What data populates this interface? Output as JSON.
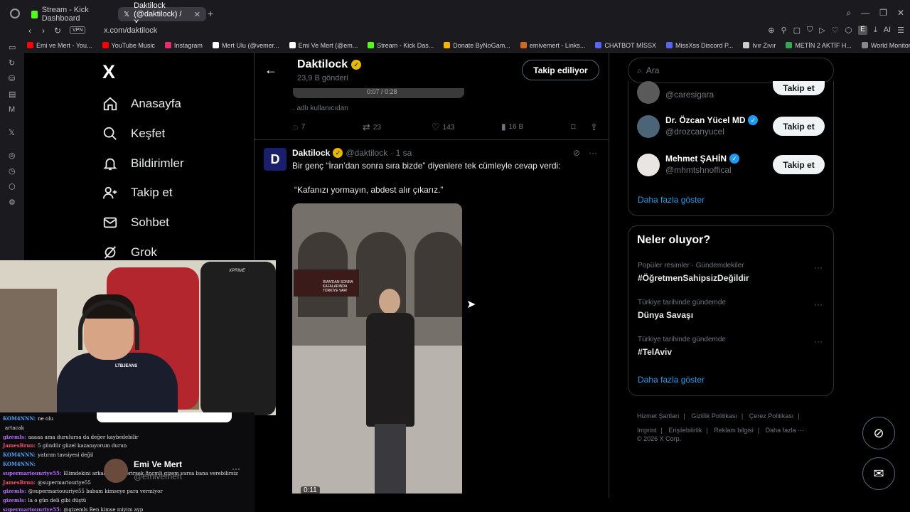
{
  "browser": {
    "tabs": [
      {
        "label": "Stream - Kick Dashboard",
        "color": "#53fc18",
        "active": false
      },
      {
        "label": "Daktilock (@daktilock) / X",
        "color": "#ffffff",
        "active": true
      }
    ],
    "url": "x.com/daktilock",
    "vpn_label": "VPN",
    "ext_label": "E",
    "ai_label": "AI",
    "bookmarks": [
      {
        "label": "Emi ve Mert - You...",
        "color": "#ff0000"
      },
      {
        "label": "YouTube Music",
        "color": "#ff0000"
      },
      {
        "label": "Instagram",
        "color": "#e1306c"
      },
      {
        "label": "Mert Ulu (@vemer...",
        "color": "#ffffff"
      },
      {
        "label": "Emi Ve Mert (@em...",
        "color": "#ffffff"
      },
      {
        "label": "Stream - Kick Das...",
        "color": "#53fc18"
      },
      {
        "label": "Donate ByNoGam...",
        "color": "#f5b400"
      },
      {
        "label": "emivemert - Links...",
        "color": "#d2691e"
      },
      {
        "label": "CHATBOT MİSSX",
        "color": "#5865f2"
      },
      {
        "label": "MissXss Discord P...",
        "color": "#5865f2"
      },
      {
        "label": "Ivır Zıvır",
        "color": "#cccccc"
      },
      {
        "label": "METİN 2 AKTİF H...",
        "color": "#34a853"
      },
      {
        "label": "World Monitor - R...",
        "color": "#888888"
      }
    ]
  },
  "nav": {
    "logo": "X",
    "items": [
      {
        "label": "Anasayfa",
        "icon": "home-icon"
      },
      {
        "label": "Keşfet",
        "icon": "search-icon"
      },
      {
        "label": "Bildirimler",
        "icon": "bell-icon"
      },
      {
        "label": "Takip et",
        "icon": "follow-icon"
      },
      {
        "label": "Sohbet",
        "icon": "mail-icon"
      },
      {
        "label": "Grok",
        "icon": "grok-icon"
      }
    ]
  },
  "profile": {
    "name": "Daktilock",
    "posts": "23,9 B gönderi",
    "follow_state": "Takip ediliyor"
  },
  "prev_tweet": {
    "video_time": "0:07 / 0:28",
    "source_note": ". adlı kullanıcıdan",
    "replies": "7",
    "reposts": "23",
    "likes": "143",
    "views": "16 B"
  },
  "tweet": {
    "avatar_letter": "D",
    "name": "Daktilock",
    "handle": "@daktilock",
    "time": "· 1 sa",
    "text": "Bir genç “İran’dan sonra sıra bizde” diyenlere tek cümleyle cevap verdi:",
    "quote": "“Kafanızı yormayın, abdest alır çıkarız.”",
    "inset_caption": "İRAN'DAN SONRA KAFALARINDA TÜRKİYE VAR!",
    "video_duration": "0:11"
  },
  "search": {
    "placeholder": "Ara"
  },
  "who_to_follow": [
    {
      "name": "",
      "handle": "@caresigara",
      "button": "Takip et",
      "verified": false
    },
    {
      "name": "Dr. Özcan Yücel MD",
      "handle": "@drozcanyucel",
      "button": "Takip et",
      "verified": true
    },
    {
      "name": "Mehmet ŞAHİN",
      "handle": "@mhmtshnoffical",
      "button": "Takip et",
      "verified": true
    }
  ],
  "show_more": "Daha fazla göster",
  "trends": {
    "title": "Neler oluyor?",
    "items": [
      {
        "context": "Popüler resimler · Gündemdekiler",
        "name": "#ÖğretmenSahipsizDeğildir"
      },
      {
        "context": "Türkiye tarihinde gündemde",
        "name": "Dünya Savaşı"
      },
      {
        "context": "Türkiye tarihinde gündemde",
        "name": "#TelAviv"
      }
    ],
    "show_more": "Daha fazla göster"
  },
  "footer": {
    "links": [
      "Hizmet Şartları",
      "Gizlilik Politikası",
      "Çerez Politikası",
      "Imprint",
      "Erişilebilirlik",
      "Reklam bilgisi",
      "Daha fazla ···"
    ],
    "copyright": "© 2026 X Corp."
  },
  "webcam": {
    "shirt_text": "LTBJEANS",
    "chair_brand": "XPRIME"
  },
  "chat": {
    "lines": [
      {
        "user": "KOM4NNN:",
        "msg": "ne olu",
        "color": "#4aa3ff"
      },
      {
        "user": "",
        "msg": "artacak",
        "color": "#4aa3ff"
      },
      {
        "user": "gizemls:",
        "msg": "aaaaa ama durulursa da değer kaybedebilir",
        "color": "#b06cff"
      },
      {
        "user": "JamesBrun:",
        "msg": "5 gündür güzel kazanıyorum durun",
        "color": "#ff4f6a"
      },
      {
        "user": "KOM4NNN:",
        "msg": "yatırım tavsiyesi değil",
        "color": "#4aa3ff"
      },
      {
        "user": "KOM4NNN:",
        "msg": "",
        "color": "#4aa3ff"
      },
      {
        "user": "supermariouuriye55:",
        "msg": "Elimdekini arkadaşıma verirsek 8ncmli gizem varsa bana verebilirsiz",
        "color": "#b06cff"
      },
      {
        "user": "JamesBrun:",
        "msg": "@supermariouriye55",
        "color": "#ff4f6a"
      },
      {
        "user": "gizemls:",
        "msg": "@supermariouuriye55 babam kimseye para vermiyor",
        "color": "#b06cff"
      },
      {
        "user": "gizemls:",
        "msg": "la o gün deli gibi düştü",
        "color": "#b06cff"
      },
      {
        "user": "supermariouuriye55:",
        "msg": "@gizemls Ben kimse miyim ayp",
        "color": "#b06cff"
      }
    ],
    "account_name": "Emi Ve Mert",
    "account_handle": "@emivemert"
  }
}
